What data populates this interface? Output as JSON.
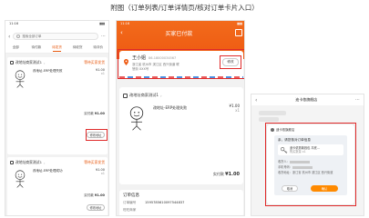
{
  "caption": "附图（订单列表/订单详情页/核对订单卡片入口）",
  "phone_list": {
    "status_time": "11:16",
    "search_placeholder": "搜索全部订单",
    "tabs": [
      "全部",
      "待付款",
      "待发货",
      "待收货",
      "待评价"
    ],
    "active_tab_index": 2,
    "orders": [
      {
        "shop": "改地址商家测试1",
        "state": "等待买家发货",
        "item_name": "改地址-ERP处理失败",
        "price": "¥1.00",
        "qty": "x1",
        "paid_label": "实付款",
        "paid_value": "¥1.00",
        "button": "修改地址"
      },
      {
        "shop": "改地址商家测试1",
        "state": "等待买家发货",
        "item_name": "改地址-ERP处理成功",
        "price": "¥1.00",
        "qty": "x1",
        "paid_label": "实付款",
        "paid_value": "¥1.00",
        "button": "修改地址"
      }
    ]
  },
  "phone_detail": {
    "status_time": "11:16",
    "title": "买家已付款",
    "recipient_name": "王小姐",
    "recipient_phone": "86-18000034567",
    "address_line1": "浙江省 杭州市 滨江区 西兴街道 联",
    "address_line2": "慧街 XXX号",
    "edit_button": "修改",
    "shop": "改地址商家测试1",
    "item_name": "改地址-ERP处理失败",
    "price": "¥1.00",
    "qty": "x1",
    "paid_label": "实付款",
    "paid_value": "¥1.00",
    "info_title": "订单信息",
    "info_rows": [
      {
        "key": "订单编号",
        "value": "1595785610097544837"
      },
      {
        "key": "旺旺商家",
        "value": ""
      }
    ]
  },
  "phone_chat": {
    "title": "迪卡侬旗舰店",
    "dialog_sender": "迪卡侬旗舰店",
    "bubble_title": "亲，请您核对订单信息",
    "product_name": "迪卡侬男款钱包 平底...",
    "product_sub": "购买数量 x1",
    "address_lines": [
      "收货人：",
      "手机号码：",
      "收货地址：浙江省 杭州市 滨江区 西兴街道"
    ],
    "cancel_label": "取消",
    "confirm_label": "确认"
  },
  "colors": {
    "accent": "#ee5a12",
    "highlight": "#e02a2a",
    "confirm": "#ff8a00"
  }
}
